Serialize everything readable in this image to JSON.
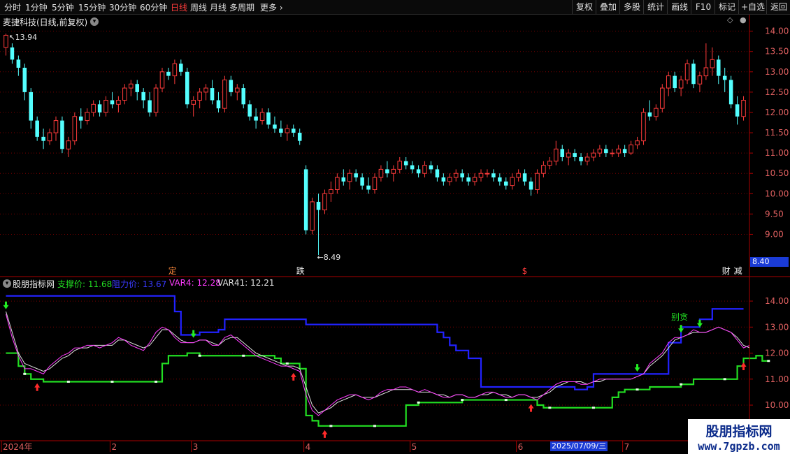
{
  "toolbar": {
    "periods": [
      "分时",
      "1分钟",
      "5分钟",
      "15分钟",
      "30分钟",
      "60分钟",
      "日线",
      "周线",
      "月线",
      "多周期",
      "更多"
    ],
    "selected": "日线",
    "right_buttons": [
      "复权",
      "叠加",
      "多股",
      "统计",
      "画线",
      "F10",
      "+自选",
      "返回"
    ],
    "mark_label": "标记"
  },
  "main_header": {
    "title": "麦捷科技(日线,前复权)"
  },
  "indicator_header": {
    "name": "股朋指标网",
    "support_label": "支撑价: 11.68",
    "resist_label": "阻力价: 13.67",
    "var4_label": "VAR4: 12.28",
    "var41_label": "VAR41: 12.21"
  },
  "annotations": {
    "high": "13.94",
    "low": "8.49",
    "current_price_box": "8.40",
    "date_highlight": "2025/07/09/三",
    "sell_text": "别贪"
  },
  "event_marks": [
    {
      "text": "定",
      "color": "#ff8a3c"
    },
    {
      "text": "跌",
      "color": "#f0f0f0"
    },
    {
      "text": "$",
      "color": "#ff3b3b"
    },
    {
      "text": "财",
      "color": "#f0f0f0"
    },
    {
      "text": "减",
      "color": "#f0f0f0"
    }
  ],
  "watermark": {
    "line1": "股朋指标网",
    "line2": "www.7gpzb.com"
  },
  "colors": {
    "up": "#ff3b3b",
    "down": "#54ffff",
    "resist": "#2222ff",
    "support": "#22dd22",
    "var4": "#ff3bff",
    "var41": "#e0e0e0",
    "grid": "#7a0000",
    "axis": "#aa0000"
  },
  "chart_data": {
    "type": "candlestick",
    "price_axis": {
      "ylim": [
        8.2,
        14.2
      ],
      "ticks": [
        9.0,
        9.5,
        10.0,
        10.5,
        11.0,
        11.5,
        12.0,
        12.5,
        13.0,
        13.5,
        14.0
      ]
    },
    "indicator_axis": {
      "ylim": [
        8.9,
        14.7
      ],
      "ticks": [
        10.0,
        11.0,
        12.0,
        13.0,
        14.0
      ]
    },
    "x_axis_labels": [
      "2024年",
      "2",
      "3",
      "4",
      "5",
      "6",
      "7",
      "8"
    ],
    "month_start_index": [
      0,
      17,
      30,
      48,
      65,
      82,
      99,
      113
    ],
    "candles": [
      [
        13.6,
        13.94,
        13.4,
        13.9
      ],
      [
        13.6,
        13.7,
        13.2,
        13.3
      ],
      [
        13.3,
        13.4,
        12.9,
        13.1
      ],
      [
        13.1,
        13.2,
        12.3,
        12.5
      ],
      [
        12.5,
        12.6,
        11.6,
        11.8
      ],
      [
        11.8,
        11.9,
        11.3,
        11.4
      ],
      [
        11.4,
        11.6,
        11.1,
        11.3
      ],
      [
        11.3,
        11.6,
        11.2,
        11.5
      ],
      [
        11.5,
        11.9,
        11.3,
        11.8
      ],
      [
        11.8,
        11.9,
        11.0,
        11.1
      ],
      [
        11.1,
        11.4,
        10.9,
        11.3
      ],
      [
        11.3,
        12.0,
        11.2,
        11.9
      ],
      [
        11.9,
        12.1,
        11.6,
        11.8
      ],
      [
        11.8,
        12.1,
        11.7,
        12.0
      ],
      [
        12.0,
        12.3,
        11.9,
        12.2
      ],
      [
        12.2,
        12.3,
        11.9,
        12.0
      ],
      [
        12.0,
        12.4,
        11.9,
        12.3
      ],
      [
        12.3,
        12.5,
        12.1,
        12.2
      ],
      [
        12.2,
        12.4,
        12.0,
        12.3
      ],
      [
        12.3,
        12.7,
        12.2,
        12.6
      ],
      [
        12.6,
        12.8,
        12.4,
        12.7
      ],
      [
        12.7,
        12.8,
        12.3,
        12.5
      ],
      [
        12.5,
        12.6,
        12.1,
        12.3
      ],
      [
        12.3,
        12.5,
        11.9,
        12.0
      ],
      [
        12.0,
        12.7,
        11.9,
        12.6
      ],
      [
        12.6,
        13.1,
        12.5,
        13.0
      ],
      [
        13.0,
        13.1,
        12.8,
        12.9
      ],
      [
        12.9,
        13.3,
        12.7,
        13.2
      ],
      [
        13.2,
        13.3,
        12.9,
        13.0
      ],
      [
        13.0,
        13.1,
        12.1,
        12.2
      ],
      [
        12.2,
        12.4,
        11.9,
        12.3
      ],
      [
        12.3,
        12.6,
        12.1,
        12.5
      ],
      [
        12.5,
        12.7,
        12.3,
        12.6
      ],
      [
        12.6,
        12.8,
        12.2,
        12.3
      ],
      [
        12.3,
        12.5,
        12.0,
        12.1
      ],
      [
        12.1,
        12.9,
        12.0,
        12.8
      ],
      [
        12.8,
        12.9,
        12.4,
        12.5
      ],
      [
        12.5,
        12.7,
        12.3,
        12.6
      ],
      [
        12.6,
        12.7,
        12.1,
        12.2
      ],
      [
        12.2,
        12.3,
        11.8,
        11.9
      ],
      [
        11.9,
        12.1,
        11.6,
        11.8
      ],
      [
        11.8,
        12.1,
        11.7,
        12.0
      ],
      [
        12.0,
        12.1,
        11.6,
        11.7
      ],
      [
        11.7,
        11.9,
        11.5,
        11.6
      ],
      [
        11.6,
        11.8,
        11.4,
        11.5
      ],
      [
        11.5,
        11.7,
        11.3,
        11.6
      ],
      [
        11.6,
        11.7,
        11.4,
        11.5
      ],
      [
        11.5,
        11.6,
        11.2,
        11.3
      ],
      [
        10.6,
        10.7,
        9.0,
        9.1
      ],
      [
        9.1,
        9.9,
        9.0,
        9.8
      ],
      [
        9.8,
        10.0,
        8.49,
        9.6
      ],
      [
        9.6,
        10.1,
        9.5,
        10.0
      ],
      [
        10.0,
        10.3,
        9.8,
        10.1
      ],
      [
        10.1,
        10.5,
        10.0,
        10.4
      ],
      [
        10.4,
        10.6,
        10.2,
        10.3
      ],
      [
        10.3,
        10.6,
        10.1,
        10.5
      ],
      [
        10.5,
        10.6,
        10.3,
        10.4
      ],
      [
        10.4,
        10.5,
        10.1,
        10.2
      ],
      [
        10.2,
        10.4,
        10.0,
        10.1
      ],
      [
        10.1,
        10.5,
        10.0,
        10.4
      ],
      [
        10.4,
        10.7,
        10.3,
        10.6
      ],
      [
        10.6,
        10.8,
        10.4,
        10.5
      ],
      [
        10.5,
        10.7,
        10.3,
        10.6
      ],
      [
        10.6,
        10.9,
        10.5,
        10.8
      ],
      [
        10.8,
        10.9,
        10.6,
        10.7
      ],
      [
        10.7,
        10.8,
        10.5,
        10.6
      ],
      [
        10.6,
        10.7,
        10.4,
        10.5
      ],
      [
        10.5,
        10.8,
        10.4,
        10.7
      ],
      [
        10.7,
        10.8,
        10.5,
        10.6
      ],
      [
        10.6,
        10.7,
        10.3,
        10.4
      ],
      [
        10.4,
        10.5,
        10.2,
        10.3
      ],
      [
        10.3,
        10.5,
        10.2,
        10.4
      ],
      [
        10.4,
        10.6,
        10.3,
        10.5
      ],
      [
        10.5,
        10.6,
        10.3,
        10.4
      ],
      [
        10.4,
        10.5,
        10.2,
        10.3
      ],
      [
        10.3,
        10.5,
        10.2,
        10.4
      ],
      [
        10.4,
        10.6,
        10.3,
        10.5
      ],
      [
        10.5,
        10.6,
        10.4,
        10.5
      ],
      [
        10.5,
        10.6,
        10.3,
        10.4
      ],
      [
        10.4,
        10.5,
        10.2,
        10.3
      ],
      [
        10.3,
        10.4,
        10.1,
        10.2
      ],
      [
        10.2,
        10.5,
        10.1,
        10.4
      ],
      [
        10.4,
        10.6,
        10.3,
        10.5
      ],
      [
        10.5,
        10.6,
        10.2,
        10.3
      ],
      [
        10.3,
        10.4,
        9.95,
        10.1
      ],
      [
        10.1,
        10.6,
        10.0,
        10.5
      ],
      [
        10.5,
        10.8,
        10.4,
        10.7
      ],
      [
        10.7,
        10.9,
        10.6,
        10.8
      ],
      [
        10.8,
        11.3,
        10.7,
        11.1
      ],
      [
        11.1,
        11.2,
        10.8,
        10.9
      ],
      [
        10.9,
        11.1,
        10.7,
        11.0
      ],
      [
        11.0,
        11.1,
        10.8,
        10.9
      ],
      [
        10.9,
        11.0,
        10.7,
        10.8
      ],
      [
        10.8,
        11.0,
        10.7,
        10.9
      ],
      [
        10.9,
        11.1,
        10.8,
        11.0
      ],
      [
        11.0,
        11.2,
        10.9,
        11.1
      ],
      [
        11.1,
        11.2,
        10.9,
        11.0
      ],
      [
        11.0,
        11.1,
        10.9,
        11.0
      ],
      [
        11.0,
        11.2,
        10.9,
        11.1
      ],
      [
        11.1,
        11.2,
        10.9,
        11.0
      ],
      [
        11.0,
        11.3,
        10.95,
        11.2
      ],
      [
        11.2,
        11.4,
        11.1,
        11.3
      ],
      [
        11.3,
        12.1,
        11.2,
        12.0
      ],
      [
        12.0,
        12.3,
        11.8,
        11.9
      ],
      [
        11.9,
        12.2,
        11.8,
        12.1
      ],
      [
        12.1,
        12.7,
        12.0,
        12.6
      ],
      [
        12.6,
        13.0,
        12.4,
        12.9
      ],
      [
        12.9,
        13.0,
        12.5,
        12.6
      ],
      [
        12.6,
        12.9,
        12.4,
        12.8
      ],
      [
        12.8,
        13.3,
        12.7,
        13.2
      ],
      [
        13.2,
        13.3,
        12.6,
        12.7
      ],
      [
        12.7,
        13.0,
        12.5,
        12.9
      ],
      [
        12.9,
        13.7,
        12.8,
        13.1
      ],
      [
        13.1,
        13.6,
        12.9,
        13.3
      ],
      [
        13.3,
        13.4,
        12.7,
        12.9
      ],
      [
        12.9,
        13.1,
        12.5,
        12.8
      ],
      [
        12.8,
        12.9,
        12.1,
        12.2
      ],
      [
        12.2,
        12.4,
        11.7,
        11.9
      ],
      [
        11.9,
        12.4,
        11.8,
        12.3
      ]
    ],
    "indicator": {
      "resist": [
        14.2,
        14.2,
        14.2,
        14.2,
        14.2,
        14.2,
        14.2,
        14.2,
        14.2,
        14.2,
        14.2,
        14.2,
        14.2,
        14.2,
        14.2,
        14.2,
        14.2,
        14.2,
        14.2,
        14.2,
        14.2,
        14.2,
        14.2,
        14.2,
        14.2,
        14.2,
        14.2,
        13.6,
        12.7,
        12.7,
        12.7,
        12.8,
        12.8,
        12.8,
        12.9,
        13.3,
        13.3,
        13.3,
        13.3,
        13.3,
        13.3,
        13.3,
        13.3,
        13.3,
        13.3,
        13.3,
        13.3,
        13.3,
        13.1,
        13.1,
        13.1,
        13.1,
        13.1,
        13.1,
        13.1,
        13.1,
        13.1,
        13.1,
        13.1,
        13.1,
        13.1,
        13.1,
        13.1,
        13.1,
        13.1,
        13.1,
        13.1,
        13.1,
        13.1,
        12.8,
        12.6,
        12.3,
        12.1,
        12.1,
        11.8,
        11.8,
        10.7,
        10.7,
        10.7,
        10.7,
        10.7,
        10.7,
        10.7,
        10.7,
        10.7,
        10.7,
        10.7,
        10.7,
        10.7,
        10.7,
        10.7,
        10.6,
        10.6,
        10.7,
        11.2,
        11.2,
        11.2,
        11.2,
        11.2,
        11.2,
        11.2,
        11.2,
        11.2,
        11.2,
        11.2,
        11.2,
        12.4,
        12.4,
        13.0,
        13.0,
        13.0,
        13.3,
        13.3,
        13.7,
        13.7,
        13.7,
        13.7,
        13.7,
        13.7
      ],
      "support": [
        12.0,
        12.0,
        11.5,
        11.2,
        11.0,
        11.0,
        10.9,
        10.9,
        10.9,
        10.9,
        10.9,
        10.9,
        10.9,
        10.9,
        10.9,
        10.9,
        10.9,
        10.9,
        10.9,
        10.9,
        10.9,
        10.9,
        10.9,
        10.9,
        10.9,
        11.6,
        11.9,
        11.9,
        11.9,
        12.0,
        12.0,
        11.9,
        11.9,
        11.9,
        11.9,
        11.9,
        11.9,
        11.9,
        11.9,
        11.9,
        11.9,
        11.9,
        11.9,
        11.8,
        11.6,
        11.6,
        11.6,
        11.4,
        9.6,
        9.4,
        9.2,
        9.2,
        9.2,
        9.2,
        9.2,
        9.2,
        9.2,
        9.2,
        9.2,
        9.2,
        9.2,
        9.2,
        9.2,
        9.2,
        10.0,
        10.0,
        10.1,
        10.1,
        10.1,
        10.1,
        10.1,
        10.1,
        10.1,
        10.2,
        10.2,
        10.2,
        10.2,
        10.2,
        10.2,
        10.2,
        10.2,
        10.2,
        10.2,
        10.2,
        10.2,
        10.0,
        9.9,
        9.9,
        9.9,
        9.9,
        9.9,
        9.9,
        9.9,
        9.9,
        9.9,
        9.9,
        9.9,
        10.3,
        10.5,
        10.6,
        10.6,
        10.6,
        10.6,
        10.7,
        10.7,
        10.7,
        10.7,
        10.7,
        10.8,
        10.8,
        11.0,
        11.0,
        11.0,
        11.0,
        11.0,
        11.0,
        11.0,
        11.5,
        11.8,
        11.8,
        11.9,
        11.7,
        11.7
      ],
      "var4": [
        13.5,
        12.6,
        11.9,
        11.4,
        11.4,
        11.3,
        11.2,
        11.5,
        11.7,
        11.9,
        12.0,
        12.2,
        12.2,
        12.3,
        12.3,
        12.2,
        12.3,
        12.4,
        12.6,
        12.5,
        12.3,
        12.2,
        12.1,
        12.4,
        12.8,
        13.0,
        12.9,
        12.6,
        12.4,
        12.4,
        12.4,
        12.5,
        12.5,
        12.3,
        12.3,
        12.6,
        12.7,
        12.5,
        12.3,
        12.1,
        11.9,
        11.8,
        11.7,
        11.6,
        11.5,
        11.5,
        11.4,
        11.3,
        10.4,
        9.8,
        9.6,
        9.8,
        10.0,
        10.2,
        10.3,
        10.4,
        10.4,
        10.3,
        10.2,
        10.3,
        10.5,
        10.6,
        10.6,
        10.7,
        10.7,
        10.6,
        10.5,
        10.6,
        10.5,
        10.4,
        10.3,
        10.3,
        10.4,
        10.4,
        10.3,
        10.3,
        10.4,
        10.5,
        10.5,
        10.4,
        10.3,
        10.3,
        10.4,
        10.4,
        10.3,
        10.2,
        10.4,
        10.6,
        10.8,
        10.9,
        10.9,
        10.9,
        10.8,
        10.8,
        10.9,
        11.0,
        11.0,
        11.0,
        11.0,
        11.0,
        11.0,
        11.1,
        11.2,
        11.6,
        11.8,
        12.0,
        12.4,
        12.6,
        12.6,
        12.7,
        12.9,
        12.8,
        12.8,
        12.9,
        13.0,
        12.9,
        12.8,
        12.5,
        12.2,
        12.3
      ],
      "var41": [
        13.6,
        12.8,
        12.0,
        11.6,
        11.5,
        11.4,
        11.3,
        11.4,
        11.6,
        11.8,
        11.9,
        12.1,
        12.2,
        12.2,
        12.3,
        12.3,
        12.3,
        12.3,
        12.5,
        12.5,
        12.4,
        12.3,
        12.2,
        12.3,
        12.6,
        12.9,
        12.9,
        12.7,
        12.5,
        12.4,
        12.4,
        12.5,
        12.5,
        12.4,
        12.3,
        12.5,
        12.6,
        12.6,
        12.4,
        12.2,
        12.0,
        11.9,
        11.8,
        11.7,
        11.6,
        11.5,
        11.5,
        11.4,
        10.7,
        10.0,
        9.7,
        9.8,
        9.9,
        10.1,
        10.2,
        10.3,
        10.4,
        10.3,
        10.3,
        10.3,
        10.4,
        10.5,
        10.6,
        10.6,
        10.6,
        10.6,
        10.5,
        10.5,
        10.5,
        10.4,
        10.4,
        10.3,
        10.4,
        10.4,
        10.3,
        10.3,
        10.4,
        10.4,
        10.5,
        10.4,
        10.4,
        10.3,
        10.4,
        10.4,
        10.3,
        10.3,
        10.4,
        10.5,
        10.7,
        10.8,
        10.9,
        10.9,
        10.9,
        10.8,
        10.9,
        10.9,
        11.0,
        11.0,
        11.0,
        11.0,
        11.0,
        11.1,
        11.2,
        11.5,
        11.7,
        11.9,
        12.2,
        12.5,
        12.6,
        12.7,
        12.8,
        12.8,
        12.8,
        12.9,
        13.0,
        12.9,
        12.8,
        12.6,
        12.3,
        12.2
      ]
    },
    "buy_signal_index": [
      5,
      46,
      51,
      84,
      118
    ],
    "sell_signal_index": [
      0,
      30,
      101,
      108,
      111
    ]
  }
}
